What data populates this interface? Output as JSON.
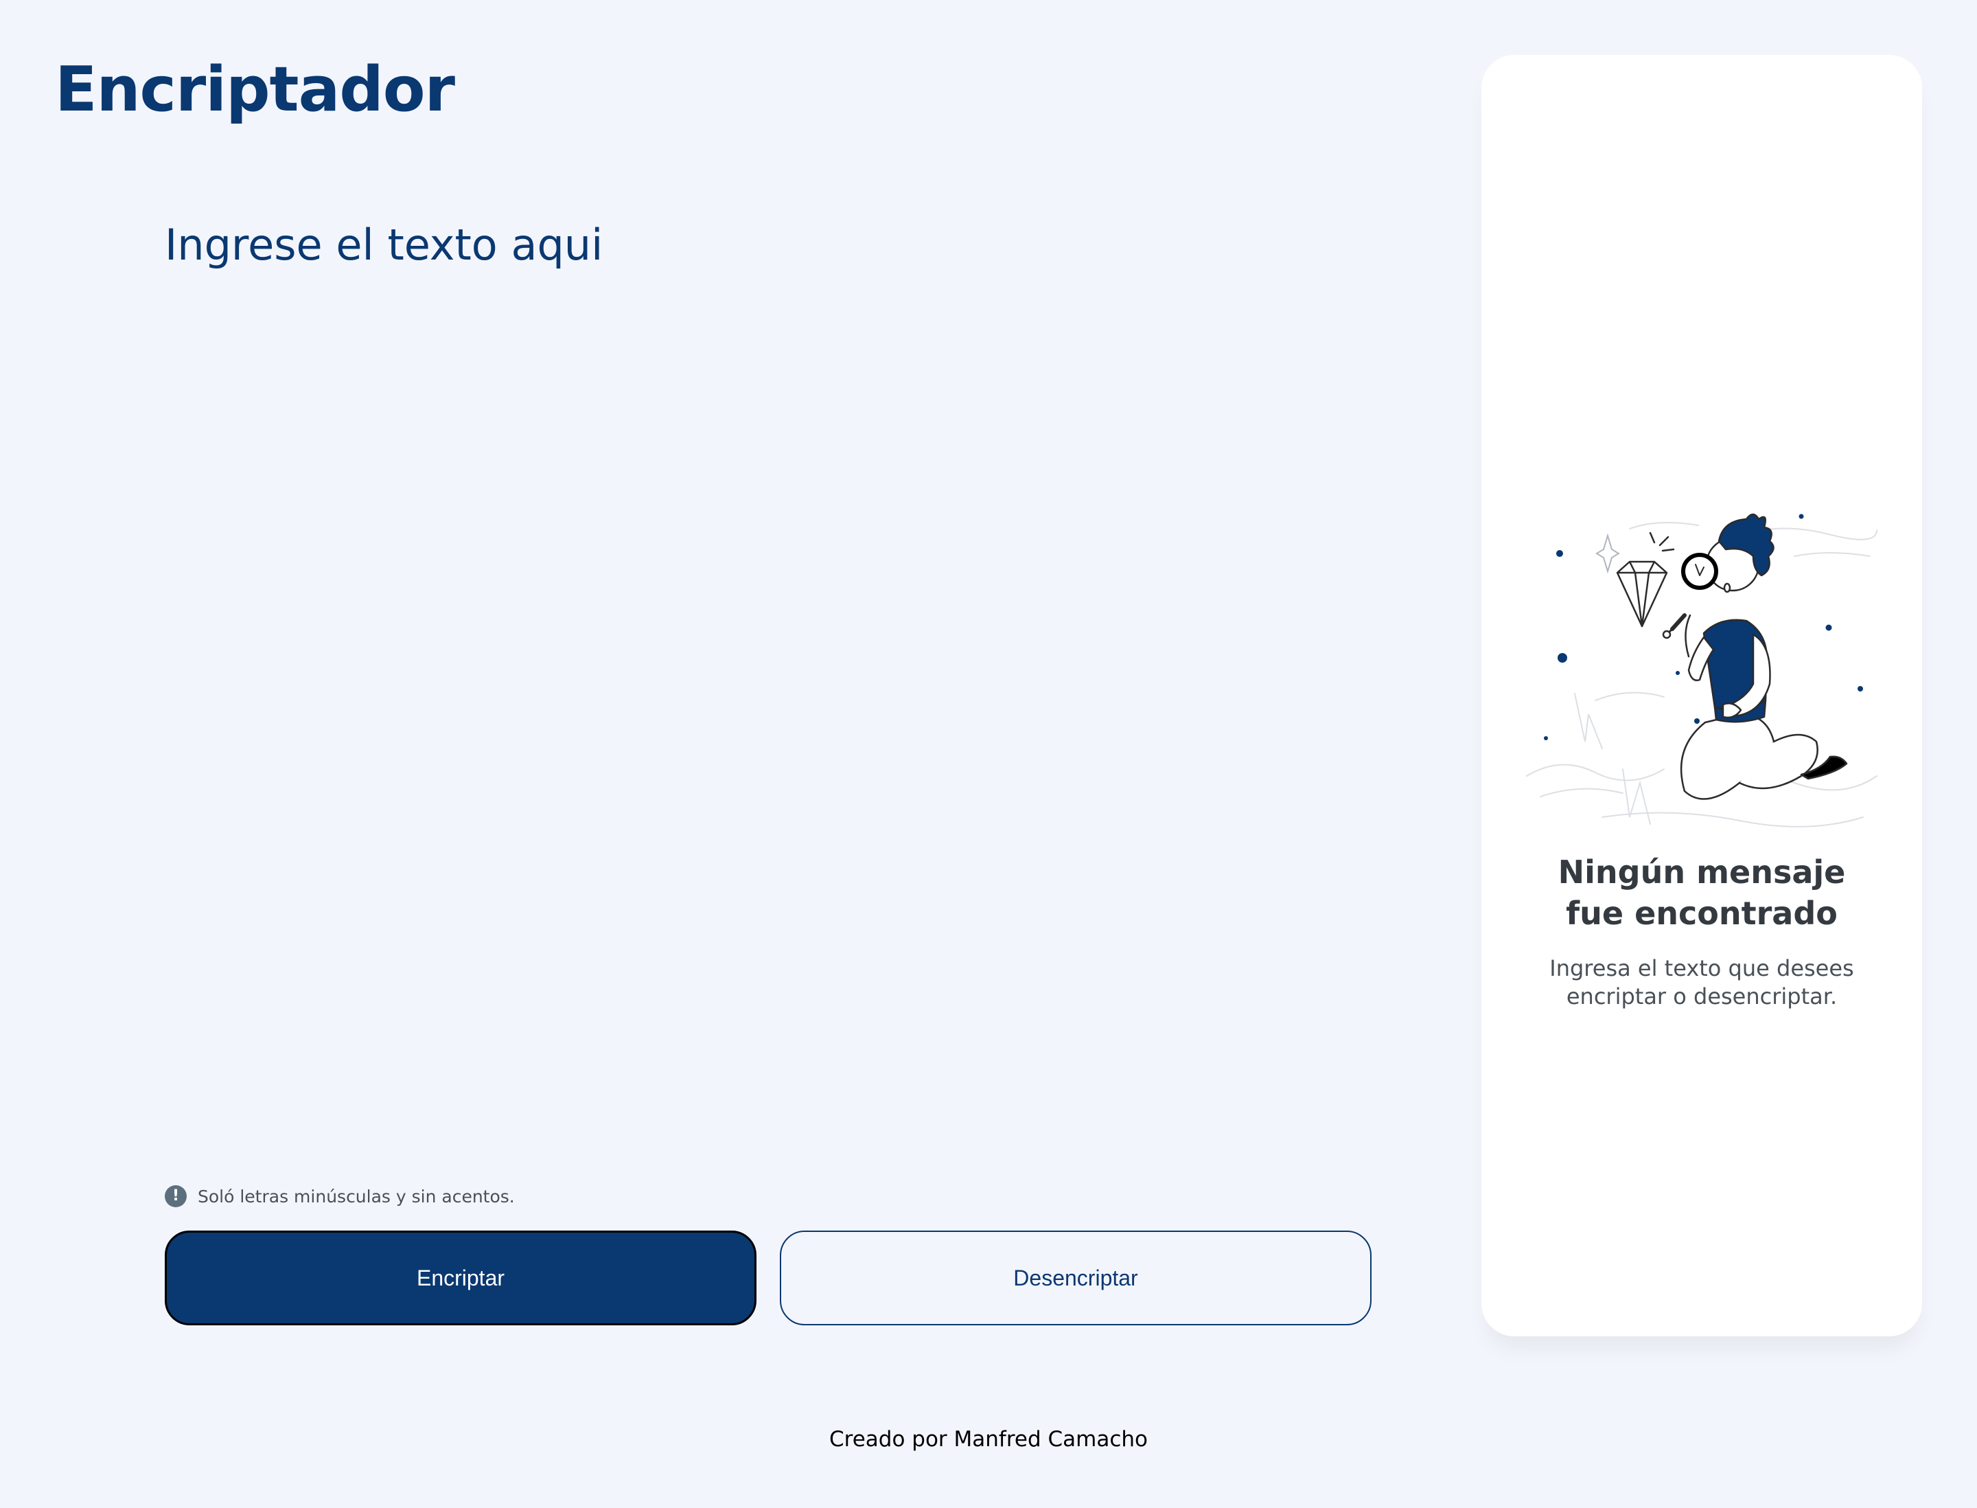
{
  "header": {
    "title": "Encriptador"
  },
  "input": {
    "placeholder": "Ingrese el texto aqui",
    "value": ""
  },
  "hint": {
    "icon": "exclamation-circle-icon",
    "text": "Soló letras minúsculas y sin acentos."
  },
  "buttons": {
    "encrypt_label": "Encriptar",
    "decrypt_label": "Desencriptar"
  },
  "output_panel": {
    "illustration": "person-with-magnifying-glass-illustration",
    "heading_line1": "Ningún mensaje",
    "heading_line2": "fue encontrado",
    "subtext_line1": "Ingresa el texto que desees",
    "subtext_line2": "encriptar o desencriptar."
  },
  "footer": {
    "credit": "Creado por Manfred Camacho"
  },
  "colors": {
    "background": "#F3F5FC",
    "primary": "#0A3871",
    "panel": "#FFFFFF",
    "heading_text": "#343A40",
    "body_text": "#495057",
    "hint_icon": "#5C6F7E"
  }
}
